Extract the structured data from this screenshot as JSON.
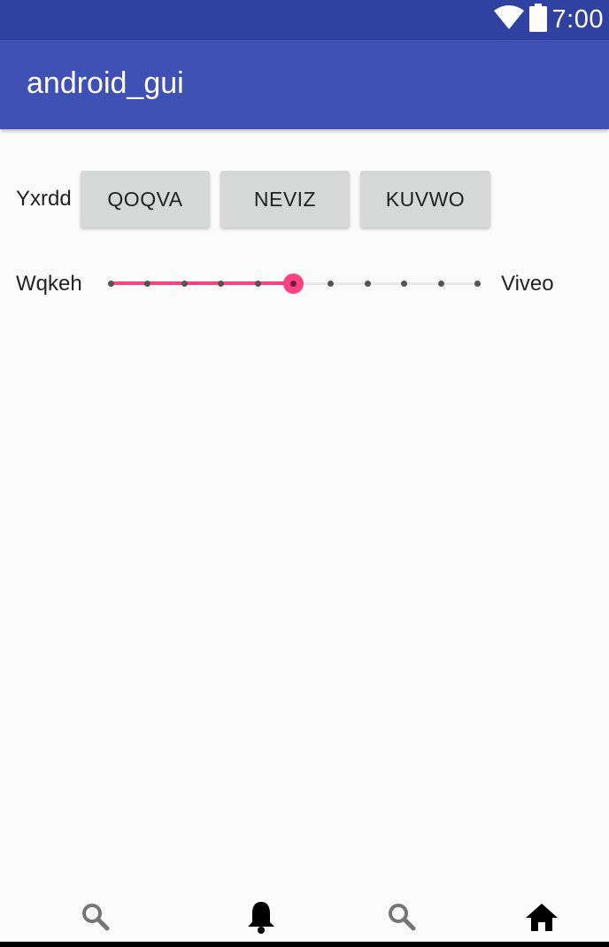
{
  "status_bar": {
    "time": "7:00",
    "icons": [
      "wifi-icon",
      "battery-icon"
    ]
  },
  "app_bar": {
    "title": "android_gui"
  },
  "row1": {
    "label": "Yxrdd",
    "buttons": [
      "QOQVA",
      "NEVIZ",
      "KUVWO"
    ]
  },
  "slider_row": {
    "left_label": "Wqkeh",
    "right_label": "Viveo",
    "steps": 10,
    "value": 5,
    "accent_color": "#ff4081"
  },
  "bottom_nav": {
    "items": [
      "search-icon",
      "bell-icon",
      "search-icon",
      "home-icon"
    ]
  },
  "colors": {
    "status_bar": "#3042a0",
    "app_bar": "#3f51b5",
    "background": "#fafafa",
    "button": "#d6d7d7"
  }
}
